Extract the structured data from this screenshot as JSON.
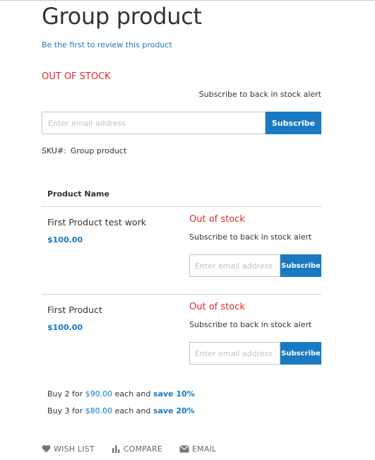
{
  "product": {
    "title": "Group product",
    "review_link": "Be the first to review this product",
    "stock_status": "OUT OF STOCK",
    "alert_text": "Subscribe to back in stock alert",
    "email_placeholder": "Enter email address",
    "subscribe_label": "Subscribe",
    "sku_label": "SKU#:",
    "sku_value": "Group product"
  },
  "grouped_table": {
    "header": "Product Name",
    "rows": [
      {
        "name": "First Product test work",
        "price": "$100.00",
        "stock_status": "Out of stock",
        "alert_text": "Subscribe to back in stock alert",
        "email_placeholder": "Enter email address",
        "subscribe_label": "Subscribe"
      },
      {
        "name": "First Product",
        "price": "$100.00",
        "stock_status": "Out of stock",
        "alert_text": "Subscribe to back in stock alert",
        "email_placeholder": "Enter email address",
        "subscribe_label": "Subscribe"
      }
    ]
  },
  "tier_prices": [
    {
      "prefix": "Buy 2 for",
      "price": "$90.00",
      "middle": "each and",
      "save": "save 10%"
    },
    {
      "prefix": "Buy 3 for",
      "price": "$80.00",
      "middle": "each and",
      "save": "save 20%"
    }
  ],
  "actions": {
    "wishlist": {
      "label": "WISH LIST",
      "icon": "heart-icon"
    },
    "compare": {
      "label": "COMPARE",
      "icon": "bar-chart-icon"
    },
    "email": {
      "label": "EMAIL",
      "icon": "envelope-icon"
    }
  },
  "colors": {
    "accent": "#1979c3",
    "out_of_stock": "#e02b27",
    "text": "#333333",
    "muted": "#666666",
    "border": "#c2c2c2"
  }
}
